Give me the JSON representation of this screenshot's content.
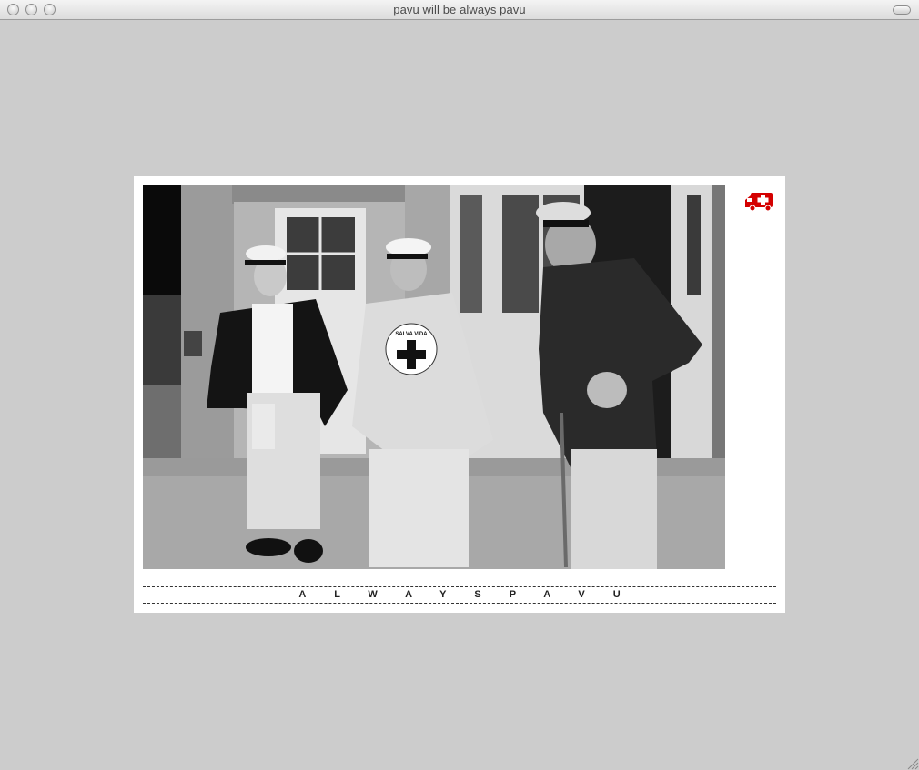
{
  "window": {
    "title": "pavu will be always pavu"
  },
  "content": {
    "photo_icon": "photo-of-three-men",
    "badge_icon": "ambulance-icon",
    "caption": "ALWAYSPAVU",
    "shirt_text": "SALVA VIDA"
  },
  "colors": {
    "background": "#cccccc",
    "card": "#ffffff",
    "ambulance": "#d40000"
  }
}
